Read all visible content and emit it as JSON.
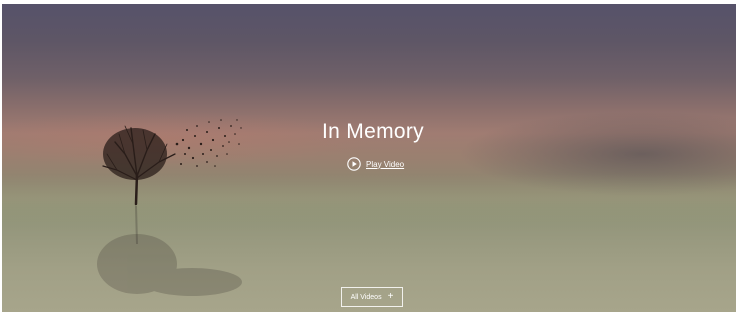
{
  "hero": {
    "title": "In Memory",
    "play_link_label": "Play Video",
    "play_icon": "play-circle-icon",
    "all_videos_label": "All Videos",
    "all_videos_icon": "plus-icon"
  },
  "colors": {
    "text": "#ffffff",
    "sky_top": "#56526a",
    "horizon": "#a07c72",
    "water": "#a1a086"
  }
}
